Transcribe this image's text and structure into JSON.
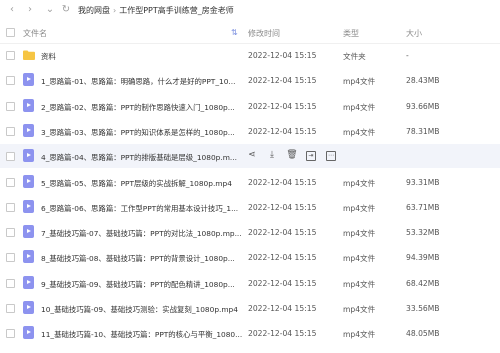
{
  "nav": {
    "back": "‹",
    "forward": "›"
  },
  "breadcrumb": [
    "我的网盘",
    "工作型PPT高手训练营_房金老师"
  ],
  "header": {
    "name": "文件名",
    "modified": "修改时间",
    "type": "类型",
    "size": "大小"
  },
  "rows": [
    {
      "name": "资料",
      "date": "2022-12-04 15:15",
      "type": "文件夹",
      "size": "-",
      "icon": "folder-icon"
    },
    {
      "name": "1_思路篇-01、思路篇：明确思路，什么才是好的PPT_10...",
      "date": "2022-12-04 15:15",
      "type": "mp4文件",
      "size": "28.43MB",
      "icon": "video-file-icon"
    },
    {
      "name": "2_思路篇-02、思路篇：PPT的制作思路快速入门_1080p...",
      "date": "2022-12-04 15:15",
      "type": "mp4文件",
      "size": "93.66MB",
      "icon": "video-file-icon"
    },
    {
      "name": "3_思路篇-03、思路篇：PPT的知识体系是怎样的_1080p...",
      "date": "2022-12-04 15:15",
      "type": "mp4文件",
      "size": "78.31MB",
      "icon": "video-file-icon"
    },
    {
      "name": "4_思路篇-04、思路篇：PPT的排版基础是层级_1080p.m...",
      "date": "",
      "type": "",
      "size": "",
      "icon": "video-file-icon",
      "hover": true
    },
    {
      "name": "5_思路篇-05、思路篇：PPT层级的实战拆解_1080p.mp4",
      "date": "2022-12-04 15:15",
      "type": "mp4文件",
      "size": "93.31MB",
      "icon": "video-file-icon"
    },
    {
      "name": "6_思路篇-06、思路篇：工作型PPT的常用基本设计技巧_1...",
      "date": "2022-12-04 15:15",
      "type": "mp4文件",
      "size": "63.71MB",
      "icon": "video-file-icon"
    },
    {
      "name": "7_基础技巧篇-07、基础技巧篇：PPT的对比法_1080p.mp...",
      "date": "2022-12-04 15:15",
      "type": "mp4文件",
      "size": "53.32MB",
      "icon": "video-file-icon"
    },
    {
      "name": "8_基础技巧篇-08、基础技巧篇：PPT的背景设计_1080p...",
      "date": "2022-12-04 15:15",
      "type": "mp4文件",
      "size": "94.39MB",
      "icon": "video-file-icon"
    },
    {
      "name": "9_基础技巧篇-09、基础技巧篇：PPT的配色精讲_1080p...",
      "date": "2022-12-04 15:15",
      "type": "mp4文件",
      "size": "68.42MB",
      "icon": "video-file-icon"
    },
    {
      "name": "10_基础技巧篇-09、基础技巧测验：实战复刻_1080p.mp4",
      "date": "2022-12-04 15:15",
      "type": "mp4文件",
      "size": "33.56MB",
      "icon": "video-file-icon"
    },
    {
      "name": "11_基础技巧篇-10、基础技巧篇：PPT的核心与平衡_1080...",
      "date": "2022-12-04 15:15",
      "type": "mp4文件",
      "size": "48.05MB",
      "icon": "video-file-icon"
    }
  ],
  "row_actions": [
    {
      "icon": "share-icon",
      "glyph": "⋖"
    },
    {
      "icon": "download-icon",
      "glyph": "⤓"
    },
    {
      "icon": "delete-icon",
      "glyph": "🗑"
    },
    {
      "icon": "copy-icon",
      "glyph": "⇥"
    },
    {
      "icon": "more-icon",
      "glyph": "⋯"
    }
  ],
  "colors": {
    "accent": "#7b8fe0",
    "video_icon": "#8d93ef",
    "folder_icon": "#f6c543",
    "hover_row": "#f2f4fa"
  }
}
